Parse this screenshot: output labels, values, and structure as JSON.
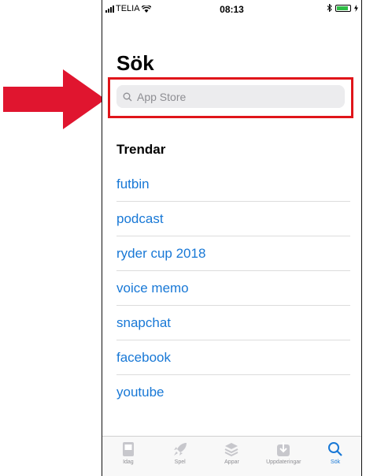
{
  "status_bar": {
    "carrier": "TELIA",
    "time": "08:13"
  },
  "page": {
    "title": "Sök"
  },
  "search": {
    "placeholder": "App Store"
  },
  "trends": {
    "heading": "Trendar",
    "items": [
      "futbin",
      "podcast",
      "ryder cup 2018",
      "voice memo",
      "snapchat",
      "facebook",
      "youtube"
    ]
  },
  "tabbar": {
    "tabs": [
      {
        "label": "Idag",
        "icon": "today-icon"
      },
      {
        "label": "Spel",
        "icon": "rocket-icon"
      },
      {
        "label": "Appar",
        "icon": "layers-icon"
      },
      {
        "label": "Uppdateringar",
        "icon": "download-icon"
      },
      {
        "label": "Sök",
        "icon": "search-icon"
      }
    ],
    "active_index": 4
  },
  "colors": {
    "accent": "#1878d6",
    "highlight_box": "#e0151a",
    "arrow": "#e0152f"
  }
}
